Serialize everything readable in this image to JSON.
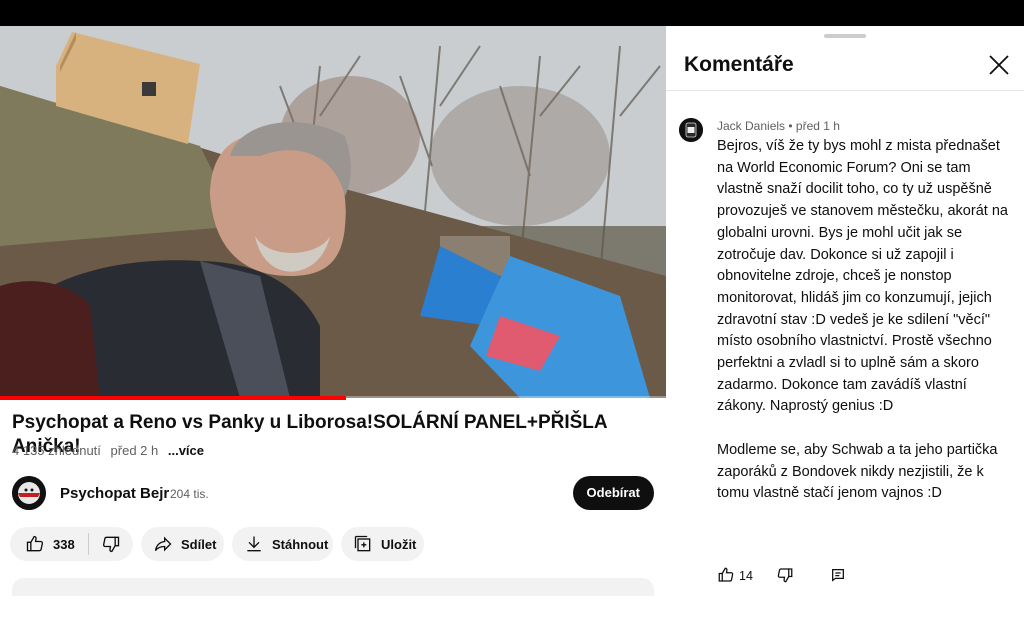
{
  "video": {
    "title": "Psychopat a Reno vs Panky u Liborosa!SOLÁRNÍ PANEL+PŘIŠLA Anička!",
    "views": "4 135 zhlédnutí",
    "age": "před 2 h",
    "more_label": "...více",
    "progress_fraction": 0.52
  },
  "channel": {
    "name": "Psychopat Bejr",
    "subscribers": "204 tis.",
    "subscribe_label": "Odebírat"
  },
  "actions": {
    "like_count": "338",
    "share_label": "Sdílet",
    "download_label": "Stáhnout",
    "save_label": "Uložit"
  },
  "comments_panel": {
    "title": "Komentáře",
    "comment": {
      "author": "Jack Daniels",
      "time": "před 1 h",
      "paragraph1": "Bejros, víš že ty bys mohl z mista přednašet na World Economic Forum? Oni se tam vlastně snaží docilit toho, co ty už uspěšně provozuješ ve stanovem městečku, akorát na globalni urovni. Bys je mohl učit jak se zotročuje dav. Dokonce si už zapojil i obnovitelne zdroje, chceš je nonstop monitorovat, hlidáš jim co konzumují, jejich zdravotní stav :D vedeš je ke sdilení \"věcí\" místo osobního vlastnictví. Prostě všechno perfektni a zvladl si to uplně sám a skoro zadarmo. Dokonce tam zavádíš vlastní zákony. Naprostý genius :D",
      "paragraph2": "Modleme se, aby Schwab a ta jeho partička zaporáků z Bondovek nikdy nezjistili, že k tomu vlastně stačí jenom vajnos :D",
      "likes": "14"
    }
  },
  "colors": {
    "accent": "#ff0000",
    "subscribe_bg": "#0f0f0f",
    "pill_bg": "#f2f2f2"
  }
}
